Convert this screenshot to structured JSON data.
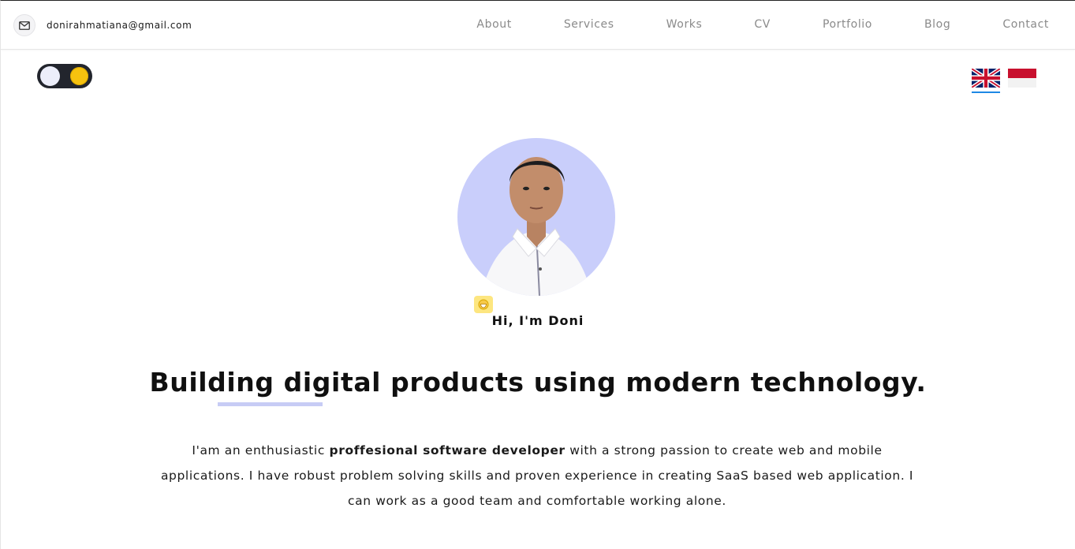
{
  "header": {
    "email": "donirahmatiana@gmail.com",
    "nav": [
      "About",
      "Services",
      "Works",
      "CV",
      "Portfolio",
      "Blog",
      "Contact"
    ]
  },
  "theme_toggle": {
    "state": "light"
  },
  "languages": {
    "options": [
      "English",
      "Indonesian"
    ],
    "selected": "English"
  },
  "hero": {
    "greeting": "Hi, I'm Doni",
    "headline": "Building digital products using modern technology.",
    "bio_before": "I'am an enthusiastic ",
    "bio_bold": "proffesional software developer",
    "bio_after": " with a strong passion to create web and mobile applications. I have robust problem solving skills and proven experience in creating SaaS based web application. I can work as a good team and comfortable working alone."
  },
  "colors": {
    "accent_soft": "#c7ccf5",
    "avatar_bg": "#c9cefb",
    "toggle_dark": "#22252d",
    "sun": "#f6c20f",
    "active_flag": "#1e88e5"
  }
}
